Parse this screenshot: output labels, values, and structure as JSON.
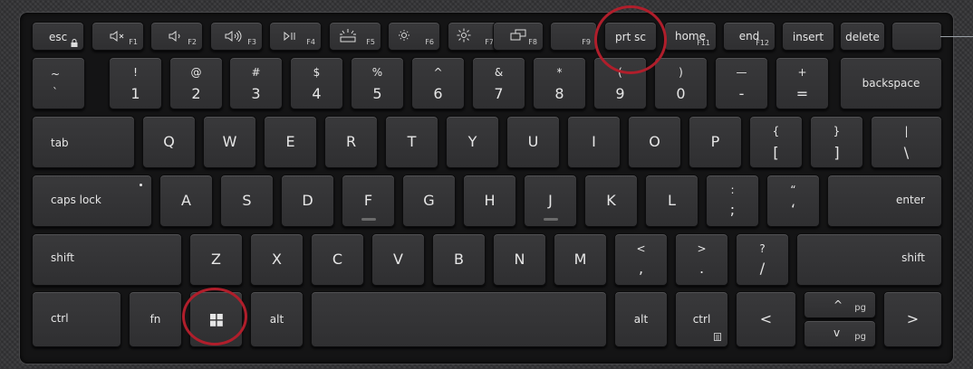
{
  "frow": [
    {
      "main": "esc",
      "fn": "",
      "icon": "lock-icon"
    },
    {
      "main": "",
      "fn": "F1",
      "icon": "mute-icon"
    },
    {
      "main": "",
      "fn": "F2",
      "icon": "volume-down-icon"
    },
    {
      "main": "",
      "fn": "F3",
      "icon": "volume-up-icon"
    },
    {
      "main": "",
      "fn": "F4",
      "icon": "play-pause-icon"
    },
    {
      "main": "",
      "fn": "F5",
      "icon": "keyboard-backlight-icon"
    },
    {
      "main": "",
      "fn": "F6",
      "icon": "brightness-down-icon"
    },
    {
      "main": "",
      "fn": "F7",
      "icon": "brightness-up-icon"
    },
    {
      "main": "",
      "fn": "F8",
      "icon": "display-switch-icon"
    },
    {
      "main": "",
      "fn": "F9",
      "icon": ""
    },
    {
      "main": "prt sc",
      "fn": "",
      "icon": ""
    },
    {
      "main": "home",
      "fn": "F11",
      "icon": ""
    },
    {
      "main": "end",
      "fn": "F12",
      "icon": ""
    },
    {
      "main": "insert",
      "fn": "",
      "icon": ""
    },
    {
      "main": "delete",
      "fn": "",
      "icon": ""
    }
  ],
  "numrow": [
    {
      "top": "~",
      "bot": "`"
    },
    {
      "top": "!",
      "bot": "1"
    },
    {
      "top": "@",
      "bot": "2"
    },
    {
      "top": "#",
      "bot": "3"
    },
    {
      "top": "$",
      "bot": "4"
    },
    {
      "top": "%",
      "bot": "5"
    },
    {
      "top": "^",
      "bot": "6"
    },
    {
      "top": "&",
      "bot": "7"
    },
    {
      "top": "*",
      "bot": "8"
    },
    {
      "top": "(",
      "bot": "9"
    },
    {
      "top": ")",
      "bot": "0"
    },
    {
      "top": "—",
      "bot": "-"
    },
    {
      "top": "+",
      "bot": "="
    }
  ],
  "backspace": "backspace",
  "tab": "tab",
  "qrow": [
    "Q",
    "W",
    "E",
    "R",
    "T",
    "Y",
    "U",
    "I",
    "O",
    "P"
  ],
  "qrow_sym": [
    {
      "top": "{",
      "bot": "["
    },
    {
      "top": "}",
      "bot": "]"
    },
    {
      "top": "|",
      "bot": "\\"
    }
  ],
  "capslock": "caps lock",
  "arow": [
    "A",
    "S",
    "D",
    "F",
    "G",
    "H",
    "J",
    "K",
    "L"
  ],
  "arow_sym": [
    {
      "top": ":",
      "bot": ";"
    },
    {
      "top": "“",
      "bot": "‘"
    }
  ],
  "enter": "enter",
  "shift_left": "shift",
  "zrow": [
    "Z",
    "X",
    "C",
    "V",
    "B",
    "N",
    "M"
  ],
  "zrow_sym": [
    {
      "top": "<",
      "bot": ","
    },
    {
      "top": ">",
      "bot": "."
    },
    {
      "top": "?",
      "bot": "/"
    }
  ],
  "shift_right": "shift",
  "ctrl_left": "ctrl",
  "fn": "fn",
  "alt_left": "alt",
  "alt_right": "alt",
  "ctrl_right": "ctrl",
  "arrow_left": "<",
  "arrow_right": ">",
  "pg_up_sym": "^",
  "pg_down_sym": "v",
  "pg_label": "pg",
  "highlight_color": "#b01e2b"
}
